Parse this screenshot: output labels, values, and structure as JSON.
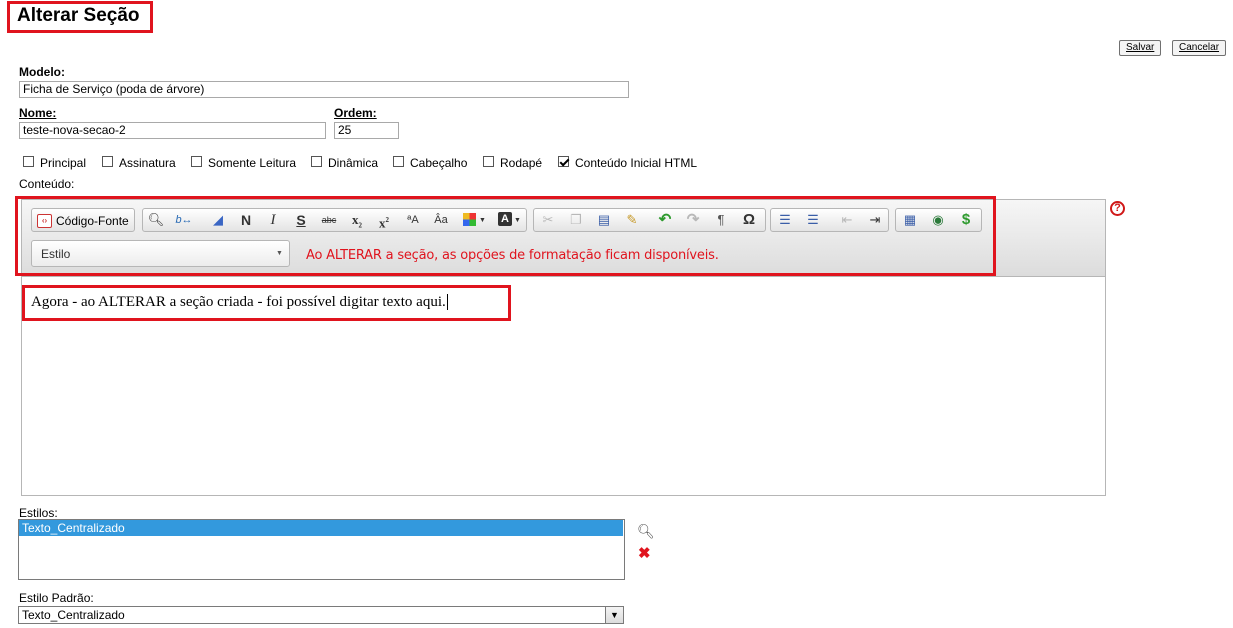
{
  "page": {
    "title": "Alterar Seção"
  },
  "buttons": {
    "save": "Salvar",
    "cancel": "Cancelar"
  },
  "form": {
    "modelo_label": "Modelo:",
    "modelo_value": "Ficha de Serviço (poda de árvore)",
    "nome_label": "Nome:",
    "nome_value": "teste-nova-secao-2",
    "ordem_label": "Ordem:",
    "ordem_value": "25",
    "checkboxes": [
      {
        "label": "Principal",
        "checked": false
      },
      {
        "label": "Assinatura",
        "checked": false
      },
      {
        "label": "Somente Leitura",
        "checked": false
      },
      {
        "label": "Dinâmica",
        "checked": false
      },
      {
        "label": "Cabeçalho",
        "checked": false
      },
      {
        "label": "Rodapé",
        "checked": false
      },
      {
        "label": "Conteúdo Inicial HTML",
        "checked": true
      }
    ],
    "conteudo_label": "Conteúdo:"
  },
  "editor": {
    "source_button": "Código-Fonte",
    "style_combo": "Estilo",
    "annotation": "Ao ALTERAR a seção, as opções de formatação ficam disponíveis.",
    "content_text": "Agora - ao ALTERAR a seção criada - foi possível digitar texto aqui."
  },
  "styles": {
    "label": "Estilos:",
    "items": [
      "Texto_Centralizado"
    ],
    "default_label": "Estilo Padrão:",
    "default_value": "Texto_Centralizado"
  },
  "colors": {
    "highlight_red": "#e0141e",
    "selection_blue": "#3399dd"
  }
}
